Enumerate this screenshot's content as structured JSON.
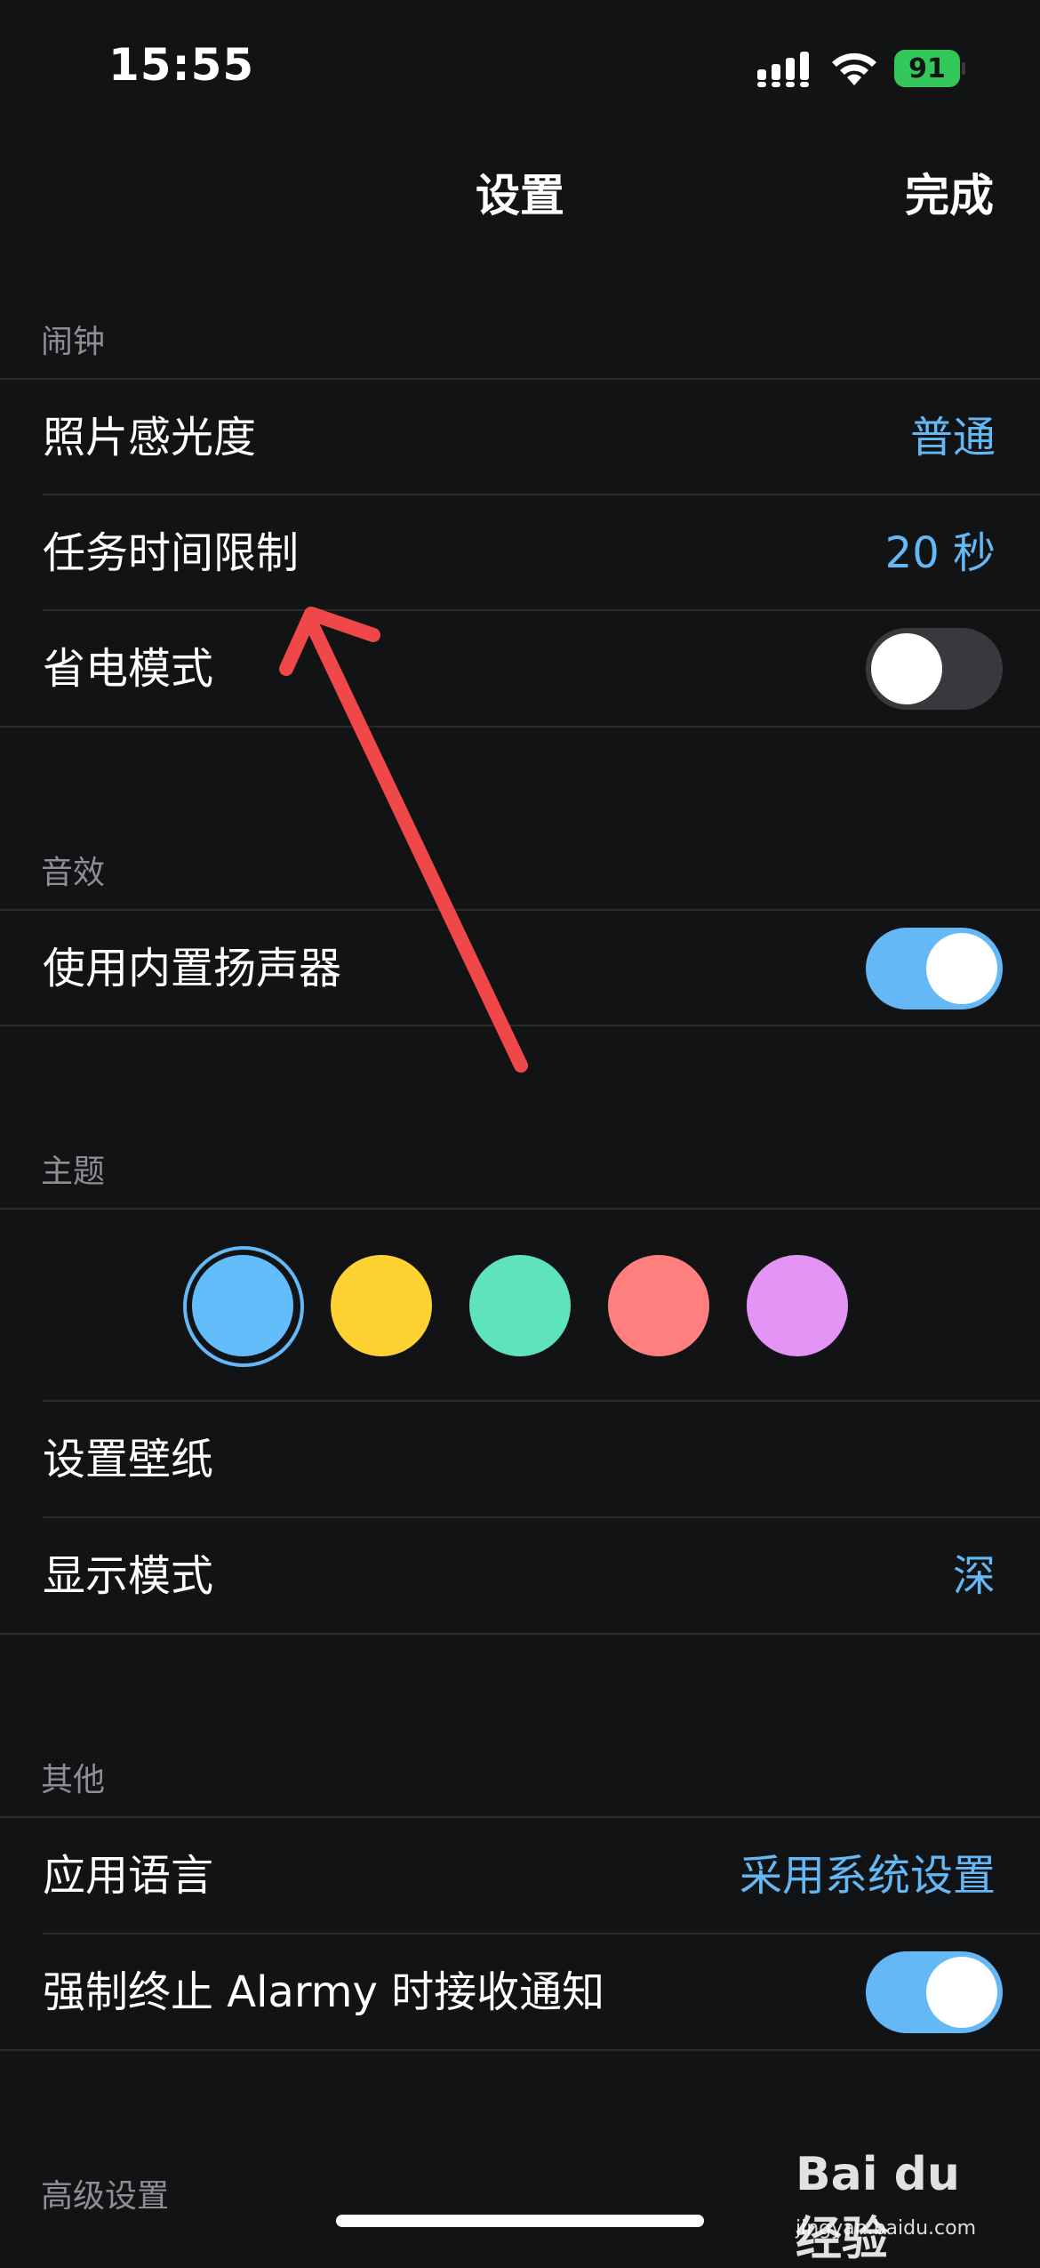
{
  "status_bar": {
    "time": "15:55",
    "battery": "91"
  },
  "nav": {
    "title": "设置",
    "done_label": "完成"
  },
  "sections": {
    "alarm": {
      "header": "闹钟",
      "rows": {
        "photo_sensitivity": {
          "label": "照片感光度",
          "value": "普通"
        },
        "task_time_limit": {
          "label": "任务时间限制",
          "value": "20 秒"
        },
        "power_saving": {
          "label": "省电模式",
          "toggle": "off"
        }
      }
    },
    "sound": {
      "header": "音效",
      "rows": {
        "builtin_speaker": {
          "label": "使用内置扬声器",
          "toggle": "on"
        }
      }
    },
    "theme": {
      "header": "主题",
      "colors": [
        {
          "name": "blue",
          "hex": "#64bdfb",
          "selected": true
        },
        {
          "name": "yellow",
          "hex": "#ffd233"
        },
        {
          "name": "green",
          "hex": "#5fe3bc"
        },
        {
          "name": "red",
          "hex": "#ff7f7f"
        },
        {
          "name": "purple",
          "hex": "#e394f5"
        }
      ],
      "rows": {
        "wallpaper": {
          "label": "设置壁纸"
        },
        "display_mode": {
          "label": "显示模式",
          "value": "深"
        }
      }
    },
    "other": {
      "header": "其他",
      "rows": {
        "app_language": {
          "label": "应用语言",
          "value": "采用系统设置"
        },
        "force_quit_notify": {
          "label": "强制终止 Alarmy 时接收通知",
          "toggle": "on"
        }
      }
    },
    "advanced": {
      "header": "高级设置"
    }
  },
  "watermark": {
    "brand": "Bai du 经验",
    "url": "jingyan.baidu.com"
  },
  "colors": {
    "background": "#121315",
    "accent": "#64b8f5",
    "annotation_arrow": "#f04848"
  }
}
